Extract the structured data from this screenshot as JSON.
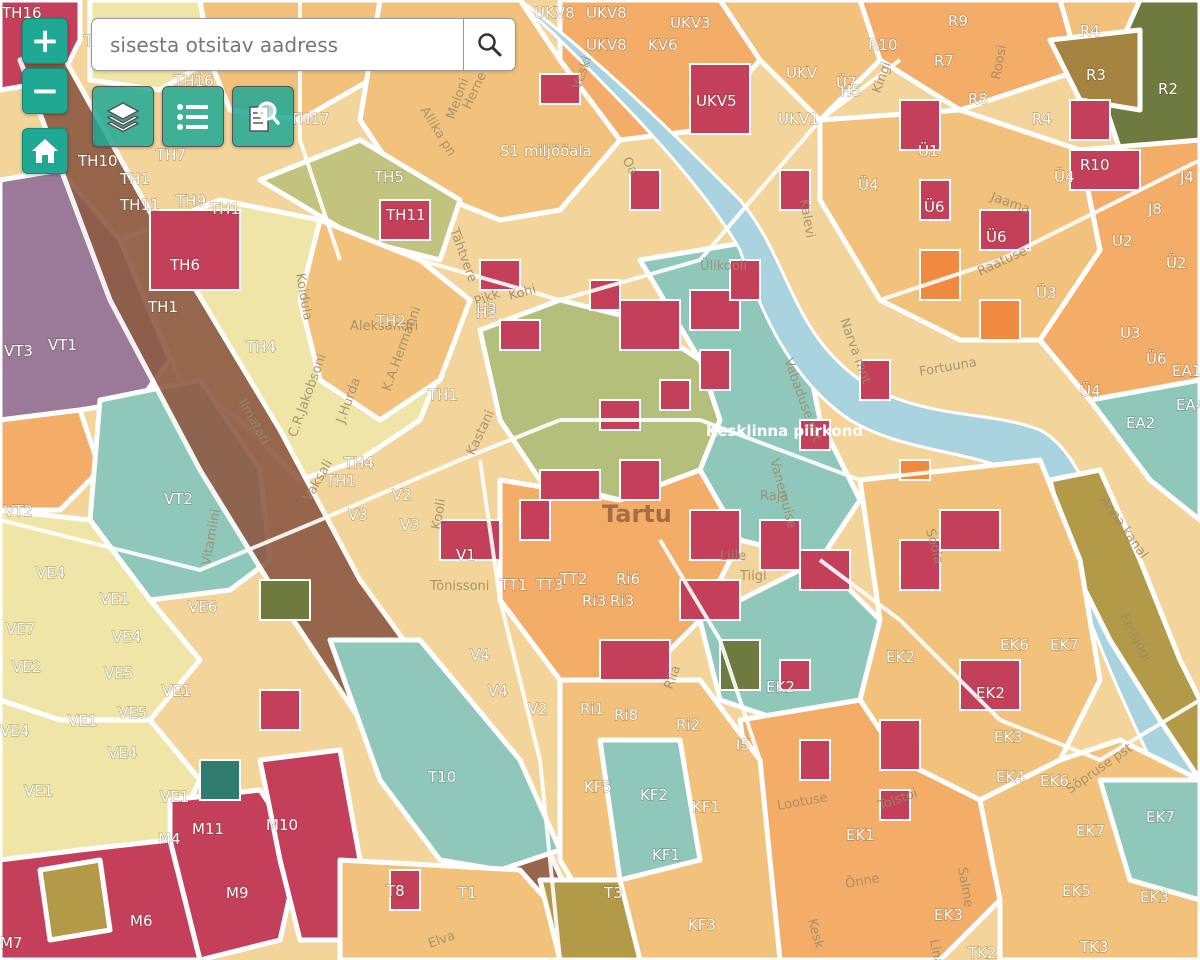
{
  "search": {
    "placeholder": "sisesta otsitav aadress",
    "value": ""
  },
  "controls": {
    "zoom_in_label": "+",
    "zoom_out_label": "−",
    "home_icon": "home-icon",
    "search_icon": "magnifier-icon",
    "tools": [
      {
        "name": "layers",
        "icon": "layers-icon"
      },
      {
        "name": "legend",
        "icon": "list-icon"
      },
      {
        "name": "query",
        "icon": "document-search-icon"
      }
    ]
  },
  "colors": {
    "accent": "#1fa894",
    "residential_low": "#eee5a6",
    "residential_mid": "#f2c27c",
    "residential_high": "#f3ad68",
    "commercial": "#c4405a",
    "green": "#b4bf7b",
    "public": "#8fc8ba",
    "industrial": "#9a7a98",
    "river": "#a9d3de",
    "railway": "#8e5a44"
  },
  "map": {
    "city_label": "Tartu",
    "district_label": "Kesklinna piirkond",
    "zone_labels": [
      "TH16",
      "TH1",
      "TH16",
      "TH17",
      "TH10",
      "TH7",
      "TH1",
      "TH11",
      "TH9",
      "TH1",
      "TH5",
      "TH11",
      "TH6",
      "TH1",
      "TH4",
      "TH2",
      "TH1",
      "TH4",
      "TH1",
      "H3",
      "S1 miljööala",
      "UKV8",
      "UKV8",
      "UKV3",
      "UKV8",
      "KV6",
      "UKV5",
      "UKV",
      "Ü7",
      "UKV1",
      "R4",
      "R9",
      "R10",
      "R7",
      "R8",
      "R3",
      "R2",
      "R4",
      "R10",
      "Ü1",
      "Ü6",
      "Ü4",
      "Ü6",
      "Ü3",
      "Ü4",
      "Ü4",
      "J8",
      "J4",
      "U2",
      "Ü2",
      "U3",
      "Ü6",
      "EA1",
      "EA4",
      "EA2",
      "VT3",
      "VT1",
      "VT2",
      "VT2",
      "V2",
      "V3",
      "V3",
      "V1",
      "V4",
      "V4",
      "V2",
      "VE4",
      "VE7",
      "VE1",
      "VE4",
      "VE6",
      "VE2",
      "VE5",
      "VE1",
      "VE1",
      "VE5",
      "VE4",
      "VE4",
      "VE1",
      "VE1",
      "TT2",
      "TT1",
      "TT3",
      "Ri6",
      "Ri3",
      "Ri3",
      "Ri8",
      "Ri2",
      "Ri1",
      "KF5",
      "KF2",
      "KF1",
      "KF1",
      "KF3",
      "T10",
      "T8",
      "T1",
      "T3",
      "M11",
      "M10",
      "M4",
      "M9",
      "M6",
      "M7",
      "EK2",
      "EK2",
      "EK2",
      "EK7",
      "EK6",
      "EK3",
      "EK4",
      "EK6",
      "EK1",
      "EK7",
      "EK7",
      "EK5",
      "EK3",
      "EK3",
      "TK3",
      "TK2",
      "I5",
      "H5",
      "H3"
    ],
    "street_labels": [
      "Allika pn",
      "Meloni",
      "Vaksali",
      "Kastani",
      "Oa",
      "Pikk",
      "Narva mnt",
      "Fortuuna",
      "Jaama",
      "Raatuse",
      "Vabaduse pst",
      "Anna kanal",
      "Emajõgi",
      "Sõpruse pst",
      "Lootuse",
      "Tolstoi",
      "Õnne",
      "Kesk",
      "Salme",
      "Lina",
      "Ilmatari",
      "C.R.Jakobsoni",
      "J.Hurda",
      "K.A.Hermanni",
      "Vitamiini",
      "Tõnissoni",
      "Kooli",
      "Herne",
      "Kohi",
      "Roosi",
      "Kingi",
      "Soola",
      "Kalevi",
      "Elva",
      "Vanemuise",
      "Tähtvere",
      "Koidula",
      "Lille",
      "Raja",
      "Tiigi",
      "Aleksandri",
      "Veski",
      "Ülikooli",
      "Riia"
    ]
  }
}
